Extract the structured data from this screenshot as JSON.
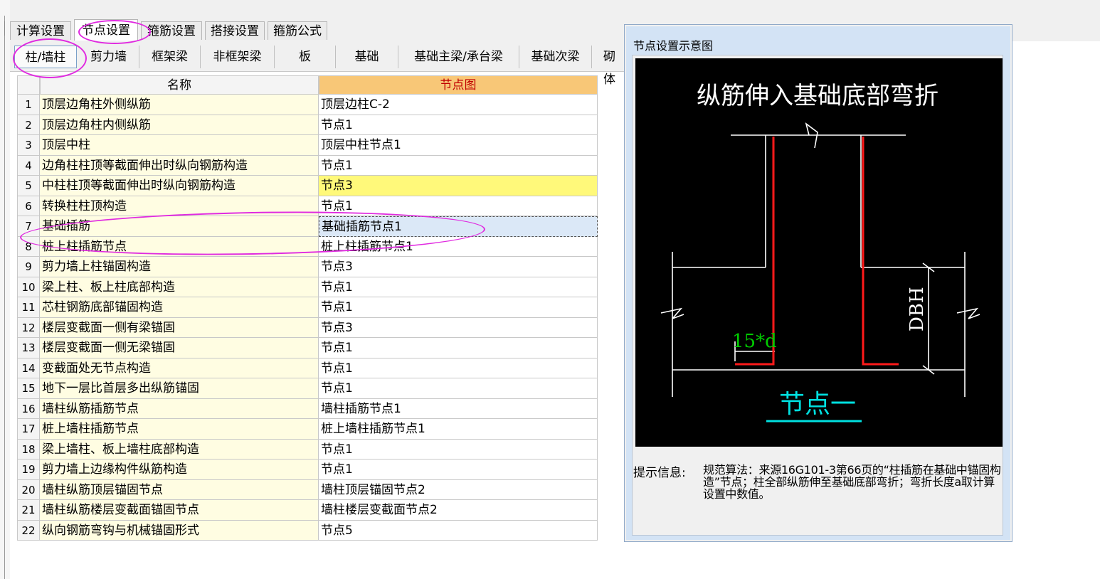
{
  "main_tabs": [
    "计算设置",
    "节点设置",
    "箍筋设置",
    "搭接设置",
    "箍筋公式"
  ],
  "sub_tabs": [
    "柱/墙柱",
    "剪力墙",
    "框架梁",
    "非框架梁",
    "板",
    "基础",
    "基础主梁/承台梁",
    "基础次梁",
    "砌体"
  ],
  "table": {
    "headers": [
      "名称",
      "节点图"
    ],
    "rows": [
      {
        "idx": "1",
        "name": "顶层边角柱外侧纵筋",
        "node": "顶层边柱C-2"
      },
      {
        "idx": "2",
        "name": "顶层边角柱内侧纵筋",
        "node": "节点1"
      },
      {
        "idx": "3",
        "name": "顶层中柱",
        "node": "顶层中柱节点1"
      },
      {
        "idx": "4",
        "name": "边角柱柱顶等截面伸出时纵向钢筋构造",
        "node": "节点1"
      },
      {
        "idx": "5",
        "name": "中柱柱顶等截面伸出时纵向钢筋构造",
        "node": "节点3"
      },
      {
        "idx": "6",
        "name": "转换柱柱顶构造",
        "node": "节点1"
      },
      {
        "idx": "7",
        "name": "基础插筋",
        "node": "基础插筋节点1"
      },
      {
        "idx": "8",
        "name": "桩上柱插筋节点",
        "node": "桩上柱插筋节点1"
      },
      {
        "idx": "9",
        "name": "剪力墙上柱锚固构造",
        "node": "节点3"
      },
      {
        "idx": "10",
        "name": "梁上柱、板上柱底部构造",
        "node": "节点1"
      },
      {
        "idx": "11",
        "name": "芯柱钢筋底部锚固构造",
        "node": "节点1"
      },
      {
        "idx": "12",
        "name": "楼层变截面一侧有梁锚固",
        "node": "节点3"
      },
      {
        "idx": "13",
        "name": "楼层变截面一侧无梁锚固",
        "node": "节点1"
      },
      {
        "idx": "14",
        "name": "变截面处无节点构造",
        "node": "节点1"
      },
      {
        "idx": "15",
        "name": "地下一层比首层多出纵筋锚固",
        "node": "节点1"
      },
      {
        "idx": "16",
        "name": "墙柱纵筋插筋节点",
        "node": "墙柱插筋节点1"
      },
      {
        "idx": "17",
        "name": "桩上墙柱插筋节点",
        "node": "桩上墙柱插筋节点1"
      },
      {
        "idx": "18",
        "name": "梁上墙柱、板上墙柱底部构造",
        "node": "节点1"
      },
      {
        "idx": "19",
        "name": "剪力墙上边缘构件纵筋构造",
        "node": "节点1"
      },
      {
        "idx": "20",
        "name": "墙柱纵筋顶层锚固节点",
        "node": "墙柱顶层锚固节点2"
      },
      {
        "idx": "21",
        "name": "墙柱纵筋楼层变截面锚固节点",
        "node": "墙柱楼层变截面节点2"
      },
      {
        "idx": "22",
        "name": "纵向钢筋弯钩与机械锚固形式",
        "node": "节点5"
      }
    ]
  },
  "dialog": {
    "title": "节点设置示意图",
    "drawing_title": "纵筋伸入基础底部弯折",
    "dim_label": "DBH",
    "bend_label": "15*d",
    "node_caption": "节点一",
    "hint_label": "提示信息:",
    "hint_text": "规范算法：来源16G101-3第66页的“柱插筋在基础中锚固构造”节点；柱全部纵筋伸至基础底部弯折；弯折长度a取计算设置中数值。"
  },
  "colors": {
    "annotation": "#e02ae0",
    "header_node_bg": "#f8c777",
    "name_col_bg": "#fffde2",
    "highlight_row": "#fff97a",
    "selected_cell": "#dbe8f7",
    "rebar": "#ff1a1a",
    "dimension_text": "#00cc00",
    "caption": "#00e0e0"
  }
}
